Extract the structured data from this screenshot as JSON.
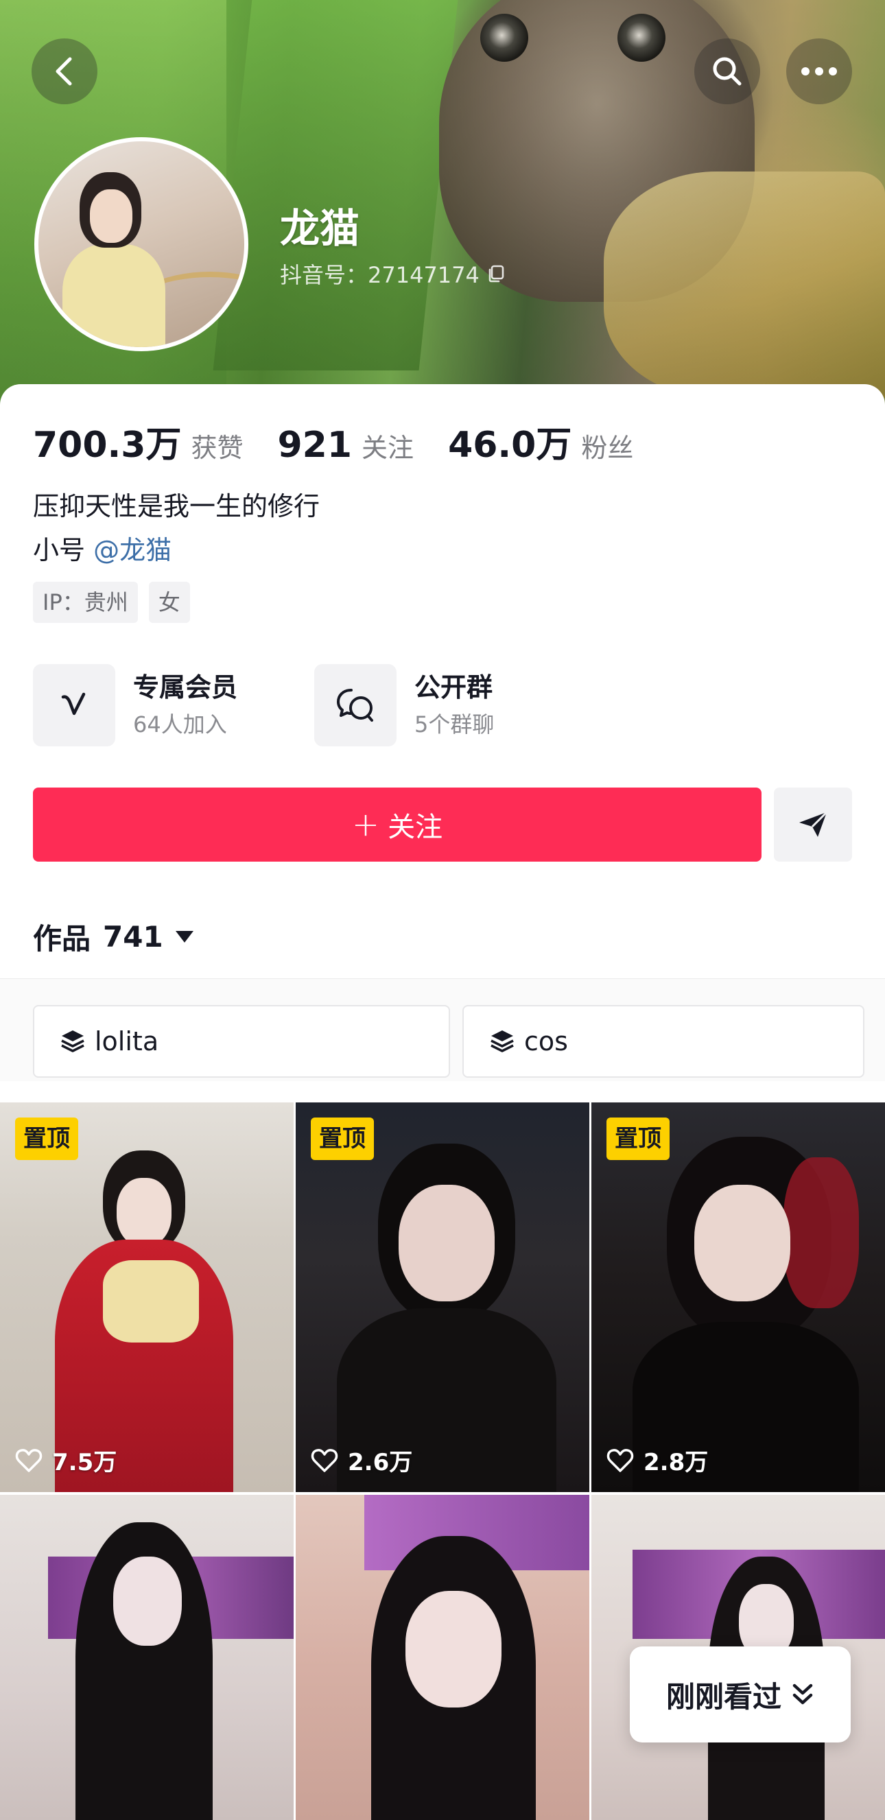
{
  "header": {
    "name": "龙猫",
    "douyin_id": "抖音号：27147174",
    "icons": {
      "back": "back-icon",
      "search": "search-icon",
      "more": "more-icon",
      "copy": "copy-icon"
    }
  },
  "stats": [
    {
      "value": "700.3万",
      "label": "获赞"
    },
    {
      "value": "921",
      "label": "关注"
    },
    {
      "value": "46.0万",
      "label": "粉丝"
    }
  ],
  "bio": {
    "line1": "压抑天性是我一生的修行",
    "line2_prefix": "小号 ",
    "mention": "@龙猫"
  },
  "tags": [
    "IP：贵州",
    "女"
  ],
  "features": [
    {
      "title": "专属会员",
      "subtitle": "64人加入",
      "icon": "v-member-icon"
    },
    {
      "title": "公开群",
      "subtitle": "5个群聊",
      "icon": "group-chat-icon"
    }
  ],
  "actions": {
    "follow_plus": "+",
    "follow_label": "关注",
    "send_icon": "send-icon"
  },
  "works": {
    "label": "作品",
    "count": "741"
  },
  "collections": [
    {
      "label": "lolita",
      "icon": "stack-icon"
    },
    {
      "label": "cos",
      "icon": "stack-icon"
    }
  ],
  "videos": [
    {
      "pinned": "置顶",
      "likes": "7.5万"
    },
    {
      "pinned": "置顶",
      "likes": "2.6万"
    },
    {
      "pinned": "置顶",
      "likes": "2.8万"
    },
    {
      "pinned": "",
      "likes": ""
    },
    {
      "pinned": "",
      "likes": ""
    },
    {
      "pinned": "",
      "likes": ""
    }
  ],
  "recent": {
    "label": "刚刚看过",
    "icon": "double-chevron-down-icon"
  },
  "colors": {
    "accent": "#fe2c55",
    "pin_badge": "#fdd000",
    "mention": "#3d6fa8"
  }
}
